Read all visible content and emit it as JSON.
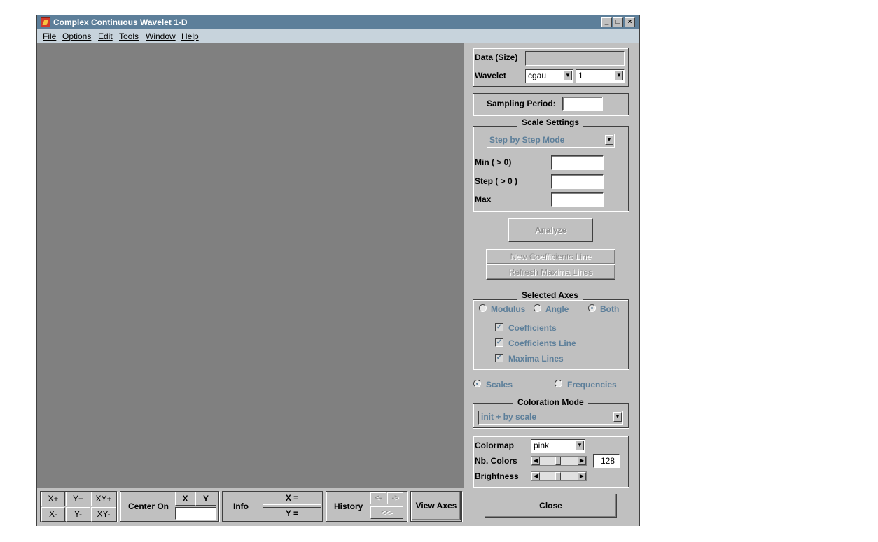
{
  "window": {
    "title": "Complex Continuous Wavelet 1-D"
  },
  "menu": [
    "File",
    "Options",
    "Edit",
    "Tools",
    "Window",
    "Help"
  ],
  "panel": {
    "data_size_label": "Data  (Size)",
    "data_size_value": "",
    "wavelet_label": "Wavelet",
    "wavelet_family": "cgau",
    "wavelet_number": "1",
    "sampling_label": "Sampling Period:",
    "sampling_value": "",
    "scale_settings_title": "Scale Settings",
    "scale_mode": "Step by Step Mode",
    "min_label": "Min  ( > 0)",
    "min_value": "",
    "step_label": "Step ( > 0 )",
    "step_value": "",
    "max_label": "Max",
    "max_value": "",
    "analyze_label": "Analyze",
    "new_coef_line_label": "New Coefficients Line",
    "refresh_maxima_label": "Refresh Maxima Lines",
    "selected_axes_title": "Selected Axes",
    "radio_modulus": "Modulus",
    "radio_angle": "Angle",
    "radio_both": "Both",
    "check_coefficients": "Coefficients",
    "check_coef_line": "Coefficients Line",
    "check_maxima": "Maxima Lines",
    "radio_scales": "Scales",
    "radio_frequencies": "Frequencies",
    "coloration_title": "Coloration Mode",
    "coloration_value": "init + by scale",
    "colormap_label": "Colormap",
    "colormap_value": "pink",
    "nb_colors_label": "Nb. Colors",
    "nb_colors_value": "128",
    "brightness_label": "Brightness",
    "close_label": "Close"
  },
  "toolbar": {
    "xplus": "X+",
    "yplus": "Y+",
    "xyplus": "XY+",
    "xminus": "X-",
    "yminus": "Y-",
    "xyminus": "XY-",
    "center_on": "Center On",
    "center_x": "X",
    "center_y": "Y",
    "center_value": "",
    "info": "Info",
    "x_readout": "X =",
    "y_readout": "Y =",
    "history": "History",
    "hist_back": "<-",
    "hist_fwd": "->",
    "hist_first": "<<-",
    "view_axes": "View Axes"
  },
  "colors": {
    "titlebar": "#5d7f9a",
    "menubar": "#c7d3dc",
    "panel": "#c0c0c0",
    "axes_area": "#808080",
    "disabled_text": "#5d7f9a"
  },
  "icons": {
    "app": "matlab-icon",
    "minimize": "minimize-icon",
    "maximize": "maximize-icon",
    "close": "close-icon"
  }
}
